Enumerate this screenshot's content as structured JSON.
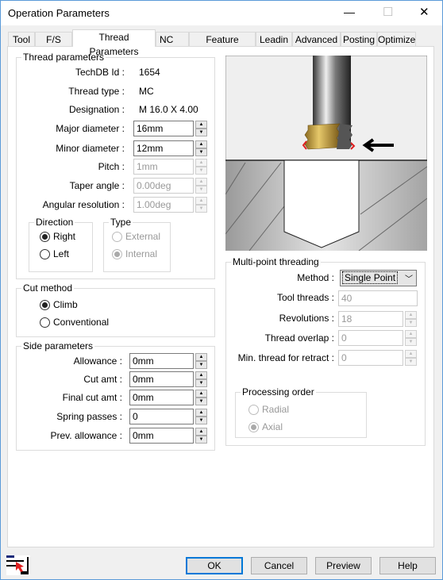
{
  "window": {
    "title": "Operation Parameters",
    "minimize": "—",
    "maximize": "☐",
    "close": "✕"
  },
  "tabs": [
    "Tool",
    "F/S",
    "Thread Parameters",
    "NC",
    "Feature Options",
    "Leadin",
    "Advanced",
    "Posting",
    "Optimize"
  ],
  "selected_tab": "Thread Parameters",
  "thread_parameters": {
    "title": "Thread parameters",
    "techdb_label": "TechDB Id :",
    "techdb": "1654",
    "thread_type_label": "Thread type :",
    "thread_type": "MC",
    "designation_label": "Designation :",
    "designation": "M 16.0 X 4.00",
    "major_label": "Major diameter :",
    "major": "16mm",
    "minor_label": "Minor diameter :",
    "minor": "12mm",
    "pitch_label": "Pitch :",
    "pitch": "1mm",
    "taper_label": "Taper angle :",
    "taper": "0.00deg",
    "angular_label": "Angular resolution :",
    "angular": "1.00deg",
    "direction": {
      "title": "Direction",
      "right": "Right",
      "left": "Left",
      "selected": "Right"
    },
    "type": {
      "title": "Type",
      "external": "External",
      "internal": "Internal",
      "selected": "Internal"
    }
  },
  "cut_method": {
    "title": "Cut method",
    "climb": "Climb",
    "conventional": "Conventional",
    "selected": "Climb"
  },
  "side_parameters": {
    "title": "Side parameters",
    "allowance_label": "Allowance :",
    "allowance": "0mm",
    "cut_amt_label": "Cut amt :",
    "cut_amt": "0mm",
    "final_cut_label": "Final cut amt :",
    "final_cut": "0mm",
    "spring_label": "Spring passes :",
    "spring": "0",
    "prev_label": "Prev. allowance :",
    "prev": "0mm"
  },
  "multi_point": {
    "title": "Multi-point threading",
    "method_label": "Method :",
    "method": "Single Point",
    "tool_threads_label": "Tool threads :",
    "tool_threads": "40",
    "revolutions_label": "Revolutions :",
    "revolutions": "18",
    "overlap_label": "Thread overlap :",
    "overlap": "0",
    "min_thread_label": "Min. thread for retract :",
    "min_thread": "0",
    "processing": {
      "title": "Processing order",
      "radial": "Radial",
      "axial": "Axial",
      "selected": "Axial"
    }
  },
  "buttons": {
    "ok": "OK",
    "cancel": "Cancel",
    "preview": "Preview",
    "help": "Help"
  },
  "colors": {
    "accent": "#0078d7",
    "thread_gold": "#c9a64a",
    "highlight_red": "#e02020"
  }
}
